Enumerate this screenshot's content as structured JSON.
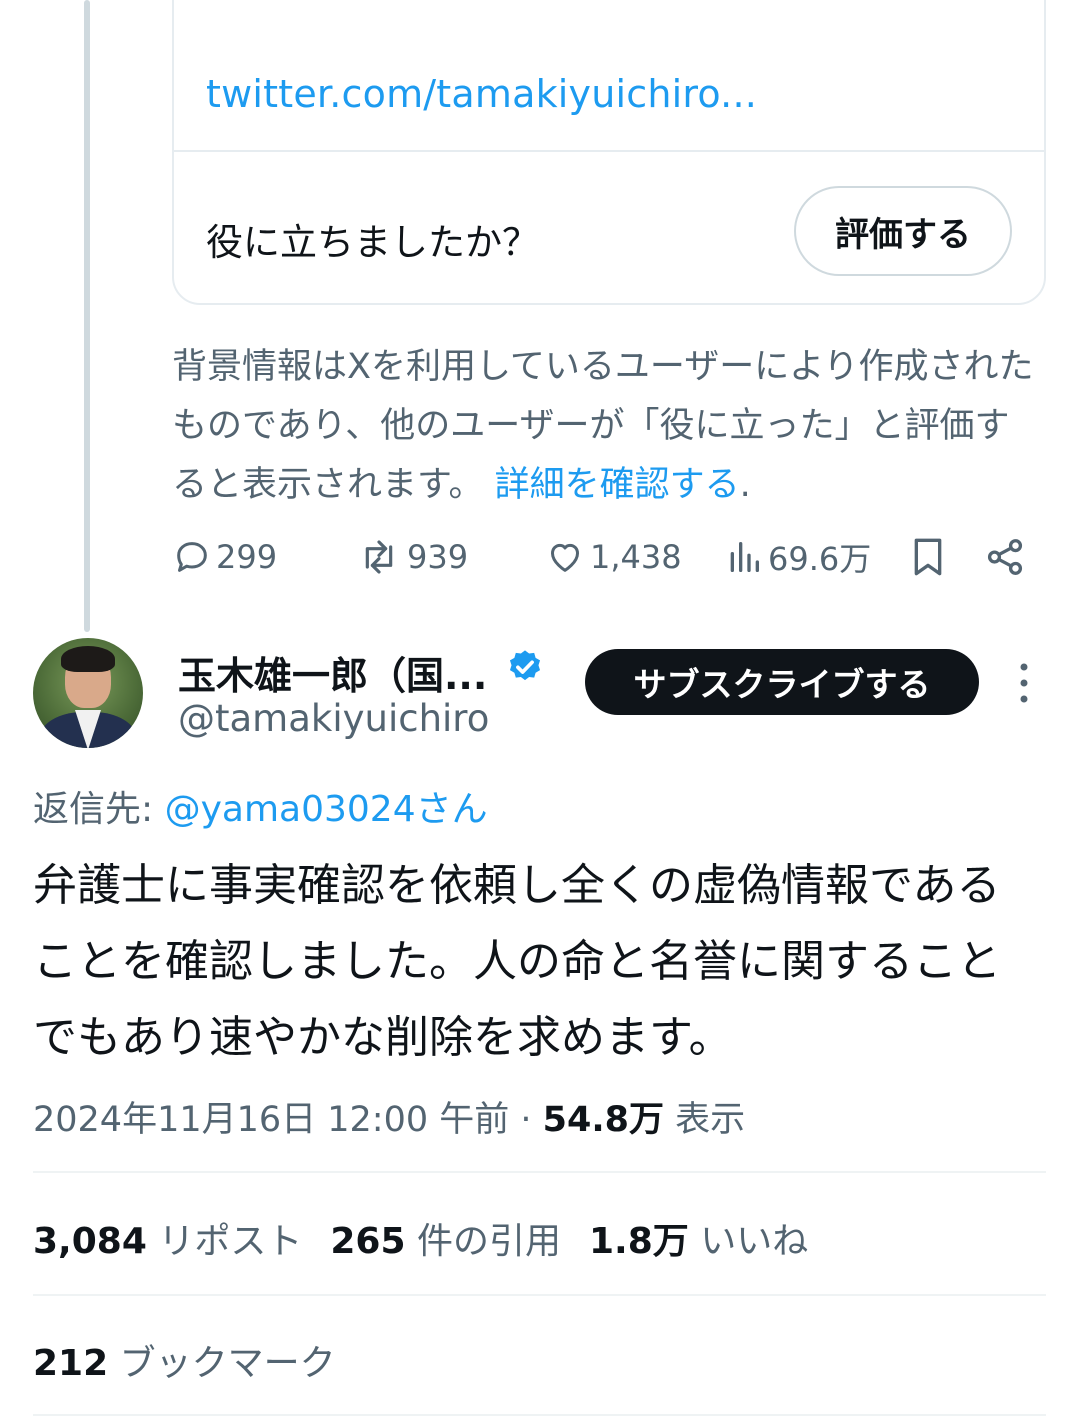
{
  "note": {
    "link": "twitter.com/tamakiyuichiro...",
    "question": "役に立ちましたか？",
    "rate_label": "評価する",
    "footer_text": "背景情報はXを利用しているユーザーにより作成されたものであり、他のユーザーが「役に立った」と評価すると表示されます。",
    "footer_link": "詳細を確認する",
    "footer_period": "."
  },
  "parent_actions": {
    "replies": "299",
    "reposts": "939",
    "likes": "1,438",
    "views": "69.6万"
  },
  "author": {
    "name": "玉木雄一郎（国...",
    "handle": "@tamakiyuichiro",
    "subscribe_label": "サブスクライブする",
    "verified_color": "#1d9bf0"
  },
  "tweet": {
    "reply_prefix": "返信先: ",
    "reply_mention": "@yama03024さん",
    "text": "弁護士に事実確認を依頼し全くの虚偽情報であることを確認しました。人の命と名誉に関することでもあり速やかな削除を求めます。",
    "time": "2024年11月16日 12:00 午前",
    "separator": " · ",
    "views_count": "54.8万",
    "views_label": " 表示"
  },
  "stats": {
    "reposts_count": "3,084",
    "reposts_label": "リポスト",
    "quotes_count": "265",
    "quotes_label": "件の引用",
    "likes_count": "1.8万",
    "likes_label": "いいね",
    "bookmarks_count": "212",
    "bookmarks_label": "ブックマーク"
  },
  "colors": {
    "link": "#1d9bf0",
    "secondary_text": "#536471",
    "primary_text": "#0f1419"
  }
}
